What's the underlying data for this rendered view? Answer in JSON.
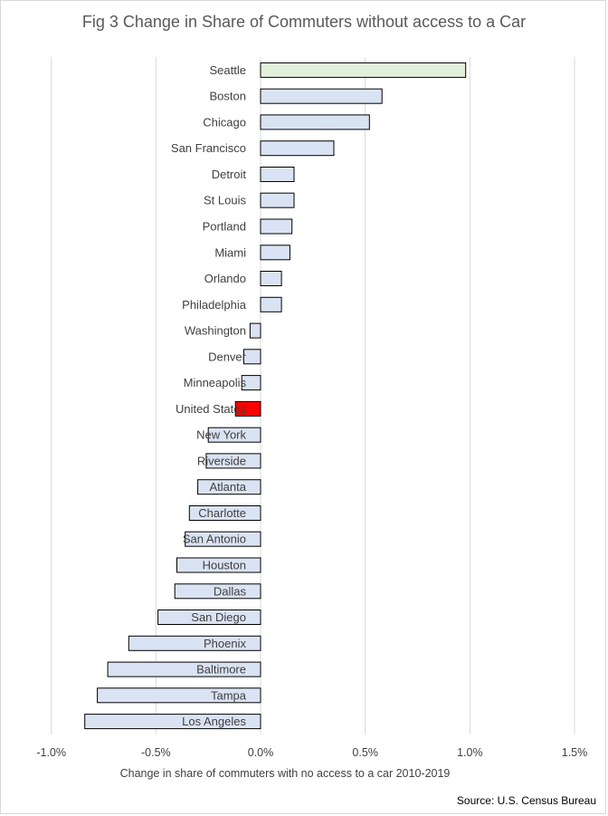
{
  "chart_data": {
    "type": "bar",
    "orientation": "horizontal",
    "title": "Fig 3 Change in Share of Commuters without access to a Car",
    "xlabel": "Change in share of commuters with no access to a car 2010-2019",
    "ylabel": "",
    "source": "Source: U.S. Census Bureau",
    "xlim": [
      -0.01,
      0.015
    ],
    "xticks": [
      -0.01,
      -0.005,
      0,
      0.005,
      0.01,
      0.015
    ],
    "xtick_labels": [
      "-1.0%",
      "-0.5%",
      "0.0%",
      "0.5%",
      "1.0%",
      "1.5%"
    ],
    "grid": true,
    "categories": [
      "Seattle",
      "Boston",
      "Chicago",
      "San Francisco",
      "Detroit",
      "St Louis",
      "Portland",
      "Miami",
      "Orlando",
      "Philadelphia",
      "Washington",
      "Denver",
      "Minneapolis",
      "United States",
      "New York",
      "Riverside",
      "Atlanta",
      "Charlotte",
      "San Antonio",
      "Houston",
      "Dallas",
      "San Diego",
      "Phoenix",
      "Baltimore",
      "Tampa",
      "Los Angeles"
    ],
    "values": [
      0.0098,
      0.0058,
      0.0052,
      0.0035,
      0.0016,
      0.0016,
      0.0015,
      0.0014,
      0.001,
      0.001,
      -0.0005,
      -0.0008,
      -0.0009,
      -0.0012,
      -0.0025,
      -0.0026,
      -0.003,
      -0.0034,
      -0.0036,
      -0.004,
      -0.0041,
      -0.0049,
      -0.0063,
      -0.0073,
      -0.0078,
      -0.0084
    ],
    "colors": {
      "default": "#dae3f3",
      "highlight_top": "#e2efda",
      "highlight_us": "#ff0000",
      "outline": "#000000",
      "grid": "#d9d9d9",
      "text": "#404040"
    }
  }
}
